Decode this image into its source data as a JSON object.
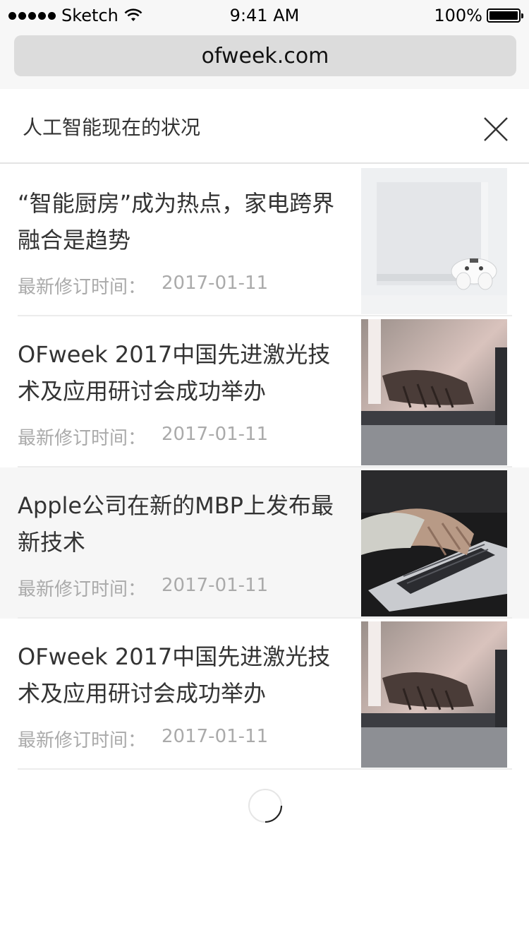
{
  "status_bar": {
    "carrier": "Sketch",
    "time": "9:41 AM",
    "battery_text": "100%",
    "battery_level": 1.0
  },
  "browser": {
    "url": "ofweek.com"
  },
  "header": {
    "title": "人工智能现在的状况",
    "close_icon": "close-icon"
  },
  "articles": [
    {
      "title": "“智能厨房”成为热点，家电跨界融合是趋势",
      "meta_label": "最新修订时间：",
      "date": "2017-01-11",
      "thumb": "game-console-image"
    },
    {
      "title": "OFweek 2017中国先进激光技术及应用研讨会成功举办",
      "meta_label": "最新修订时间：",
      "date": "2017-01-11",
      "thumb": "laptop-typing-image"
    },
    {
      "title": "Apple公司在新的MBP上发布最新技术",
      "meta_label": "最新修订时间：",
      "date": "2017-01-11",
      "thumb": "macbook-typing-image"
    },
    {
      "title": "OFweek 2017中国先进激光技术及应用研讨会成功举办",
      "meta_label": "最新修订时间：",
      "date": "2017-01-11",
      "thumb": "laptop-typing-image"
    }
  ],
  "colors": {
    "text_primary": "#333333",
    "text_secondary": "#aaaaaa",
    "divider": "#ececec",
    "highlight_row": "#f6f6f6"
  }
}
